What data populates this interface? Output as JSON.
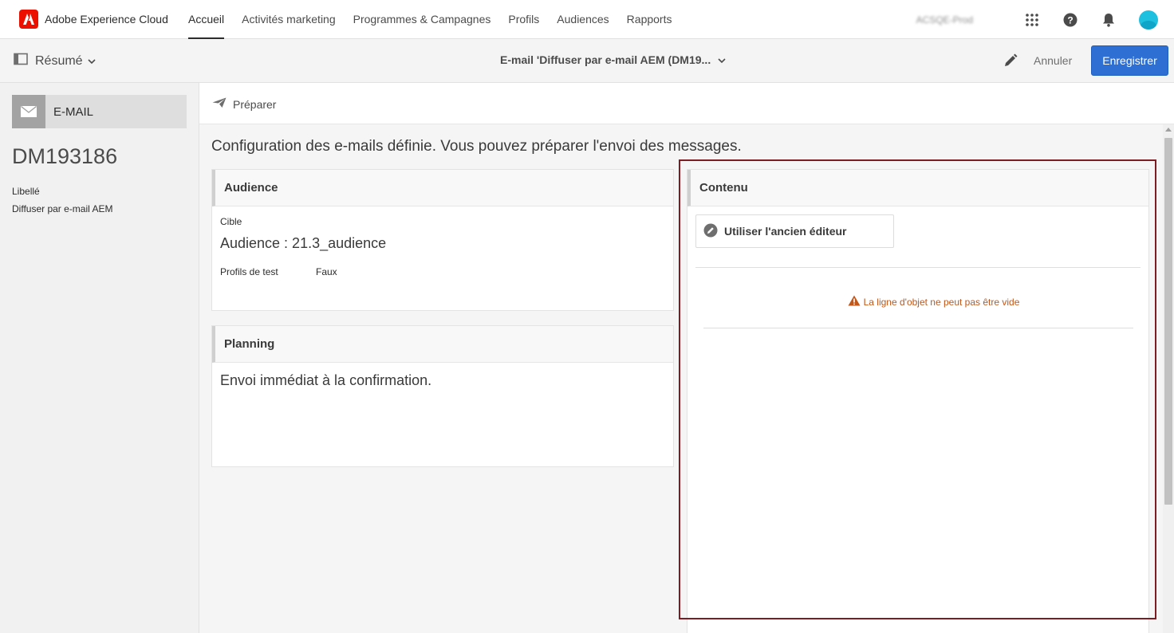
{
  "brand": {
    "name": "Adobe Experience Cloud",
    "icon": "adobe-logo-icon"
  },
  "nav": {
    "links": [
      {
        "label": "Accueil",
        "active": true
      },
      {
        "label": "Activités marketing",
        "active": false
      },
      {
        "label": "Programmes & Campagnes",
        "active": false
      },
      {
        "label": "Profils",
        "active": false
      },
      {
        "label": "Audiences",
        "active": false
      },
      {
        "label": "Rapports",
        "active": false
      }
    ],
    "org": "ACSQE-Prod",
    "icons": [
      "apps-grid-icon",
      "help-icon",
      "notifications-bell-icon",
      "user-avatar"
    ]
  },
  "subbar": {
    "summary_label": "Résumé",
    "doc_title": "E-mail 'Diffuser par e-mail AEM (DM19...",
    "cancel_label": "Annuler",
    "save_label": "Enregistrer"
  },
  "left": {
    "channel_label": "E-MAIL",
    "delivery_id": "DM193186",
    "label_field": "Libellé",
    "label_value": "Diffuser par e-mail AEM"
  },
  "main": {
    "prepare_label": "Préparer",
    "status_message": "Configuration des e-mails définie. Vous pouvez préparer l'envoi des messages.",
    "audience": {
      "title": "Audience",
      "target_label": "Cible",
      "target_value": "Audience : 21.3_audience",
      "test_label": "Profils de test",
      "test_value": "Faux"
    },
    "planning": {
      "title": "Planning",
      "text": "Envoi immédiat à la confirmation."
    },
    "content": {
      "title": "Contenu",
      "legacy_button": "Utiliser l'ancien éditeur",
      "warning": "La ligne d'objet ne peut pas être vide"
    }
  },
  "colors": {
    "accent": "#2d6fd2",
    "brand": "#eb1000",
    "warning": "#c1581a",
    "highlight": "#7d1c22"
  }
}
